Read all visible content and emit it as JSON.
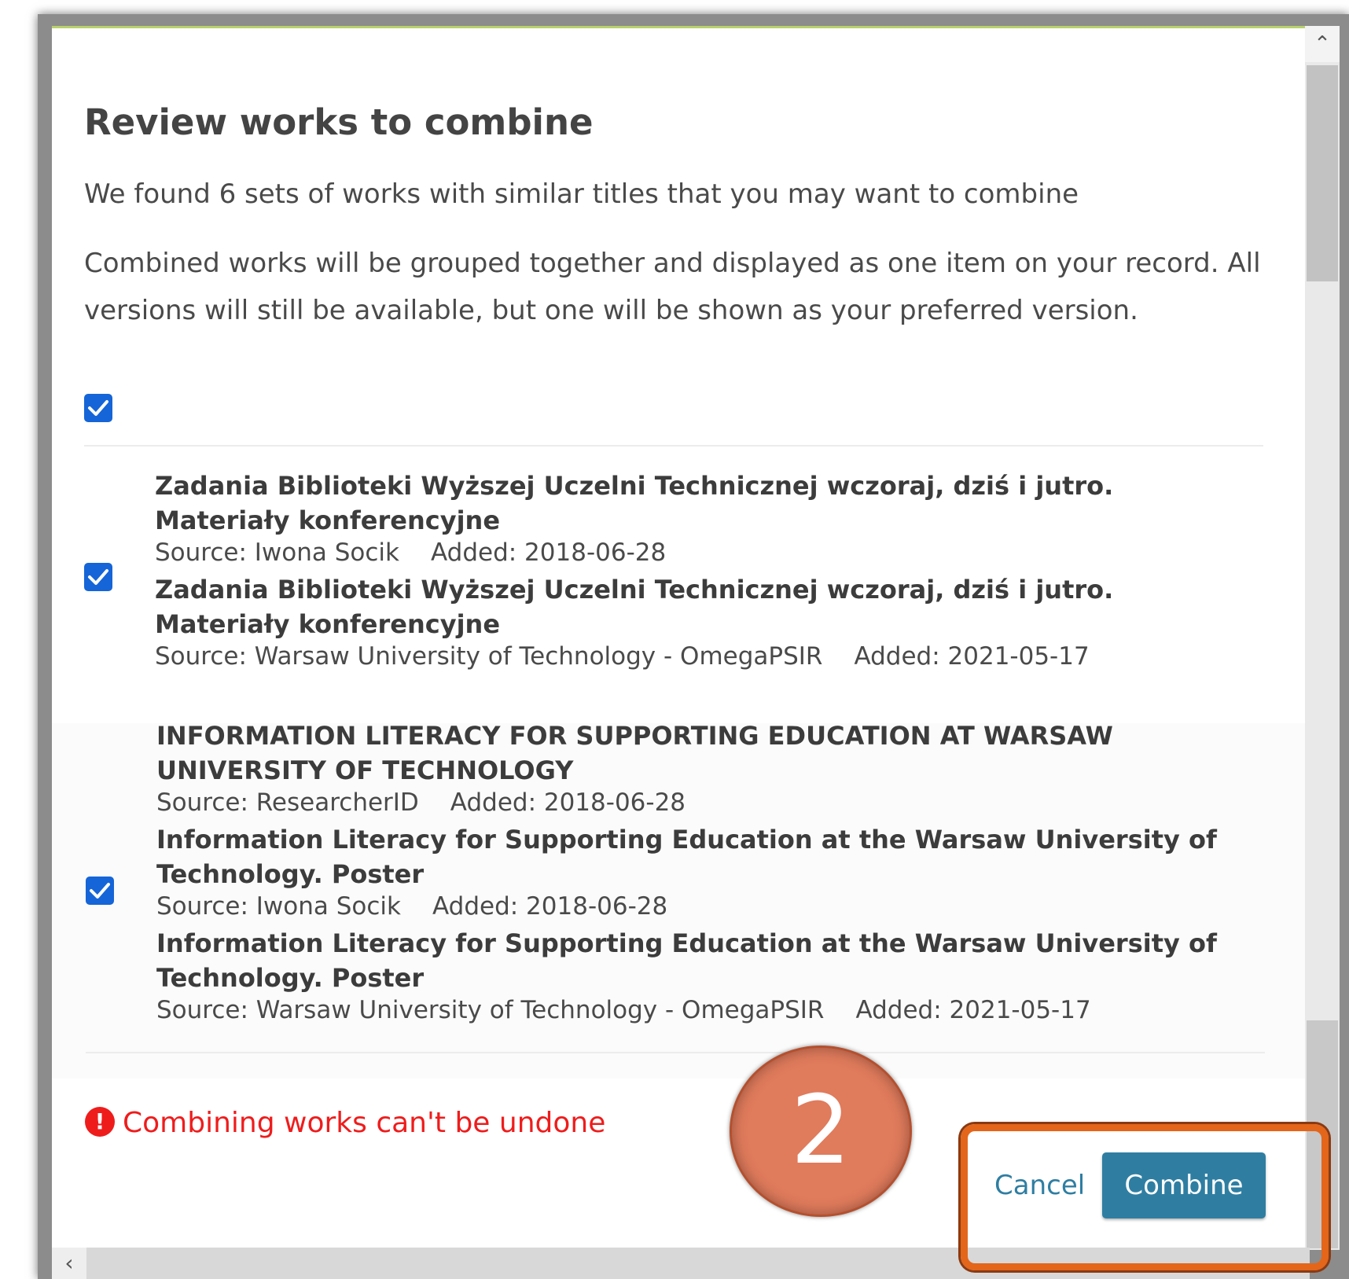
{
  "dialog": {
    "title": "Review works to combine",
    "intro": "We found 6 sets of works with similar titles that you may want to combine",
    "explanation": "Combined works will be grouped together and displayed as one item on your record. All versions will still be available, but one will be shown as your preferred version."
  },
  "groups": [
    {
      "checked": true,
      "works": [
        {
          "title": "Zadania Biblioteki Wyższej Uczelni Technicznej wczoraj, dziś i jutro. Materiały konferencyjne",
          "source": "Source: Iwona Socik",
          "added": "Added: 2018-06-28"
        },
        {
          "title": "Zadania Biblioteki Wyższej Uczelni Technicznej wczoraj, dziś i jutro. Materiały konferencyjne",
          "source": "Source: Warsaw University of Technology - OmegaPSIR",
          "added": "Added: 2021-05-17"
        }
      ]
    },
    {
      "checked": true,
      "works": [
        {
          "title": "INFORMATION LITERACY FOR SUPPORTING EDUCATION AT WARSAW UNIVERSITY OF TECHNOLOGY",
          "source": "Source: ResearcherID",
          "added": "Added: 2018-06-28"
        },
        {
          "title": "Information Literacy for Supporting Education at the Warsaw University of Technology. Poster",
          "source": "Source: Iwona Socik",
          "added": "Added: 2018-06-28"
        },
        {
          "title": "Information Literacy for Supporting Education at the Warsaw University of Technology. Poster",
          "source": "Source: Warsaw University of Technology - OmegaPSIR",
          "added": "Added: 2021-05-17"
        }
      ]
    }
  ],
  "warning": "Combining works can't be undone",
  "actions": {
    "cancel": "Cancel",
    "combine": "Combine"
  },
  "annotation": {
    "step_number": "2"
  },
  "colors": {
    "checkbox": "#1565d8",
    "primary": "#2f7ea2",
    "warning": "#ef1c1c",
    "badge": "#e07b5c",
    "highlight": "#e3661a"
  },
  "icons": {
    "check": "check-icon",
    "warning": "exclamation-circle-icon",
    "scroll_up": "chevron-up-icon",
    "scroll_left": "chevron-left-icon"
  }
}
